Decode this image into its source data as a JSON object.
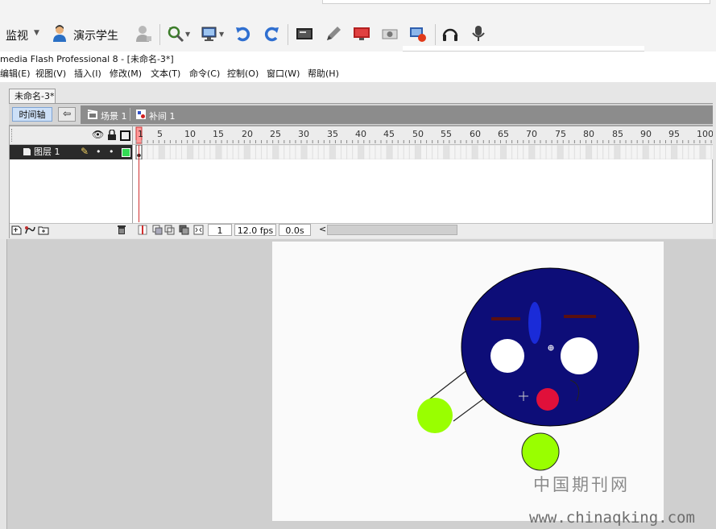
{
  "toolbar": {
    "monitor_label": "监视",
    "demo_student_label": "演示学生",
    "icons": [
      "dropdown-arrow-icon",
      "student-icon",
      "grey-user-icon",
      "refresh-search-icon",
      "monitor-icon",
      "undo-icon",
      "redo-icon",
      "screen-icon",
      "pen-icon",
      "broadcast-icon",
      "camera-icon",
      "remote-icon",
      "headset-icon",
      "microphone-icon"
    ]
  },
  "window": {
    "title": "media Flash Professional 8 - [未命名-3*]"
  },
  "menu": {
    "items": [
      "编辑(E)",
      "视图(V)",
      "插入(I)",
      "修改(M)",
      "文本(T)",
      "命令(C)",
      "控制(O)",
      "窗口(W)",
      "帮助(H)"
    ]
  },
  "document": {
    "tab_label": "未命名-3*",
    "timeline_button": "时间轴",
    "scene_label": "场景 1",
    "tween_label": "补间 1"
  },
  "timeline": {
    "layer_name": "图层 1",
    "ruler_ticks": [
      "1",
      "5",
      "10",
      "15",
      "20",
      "25",
      "30",
      "35",
      "40",
      "45",
      "50",
      "55",
      "60",
      "65",
      "70",
      "75",
      "80",
      "85",
      "90",
      "95",
      "100"
    ],
    "current_frame": "1",
    "fps": "12.0 fps",
    "elapsed": "0.0s",
    "scroll_left": "<"
  },
  "stage": {
    "face_color": "#0d0d78",
    "ball_color": "#99ff00",
    "mouth_color": "#e0103a",
    "nose_color": "#1a2bd8",
    "brow_color": "#5a1010"
  },
  "watermark": {
    "cn": "中国期刊网",
    "url": "www.chinaqking.com"
  }
}
